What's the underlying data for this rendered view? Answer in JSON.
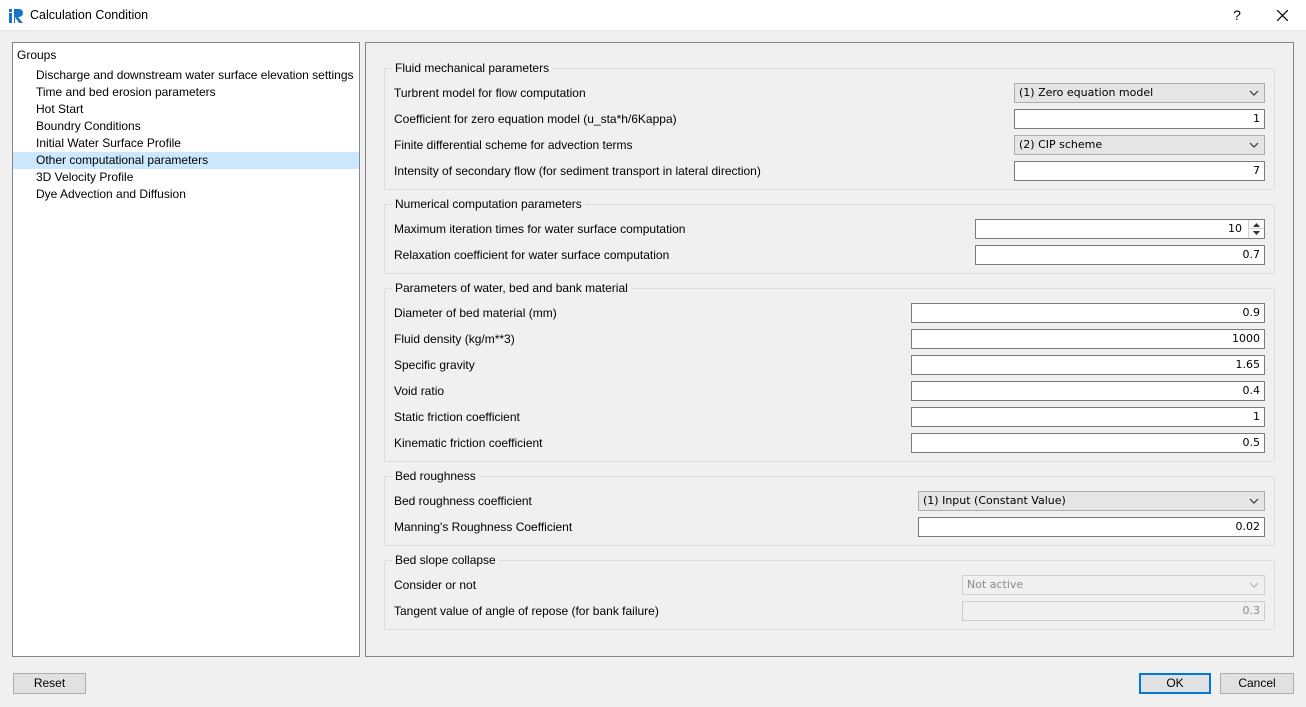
{
  "window": {
    "title": "Calculation Condition",
    "help": "?",
    "close": "✕"
  },
  "groups": {
    "header": "Groups",
    "items": [
      "Discharge and downstream water surface elevation settings",
      "Time and bed erosion parameters",
      "Hot Start",
      "Boundry Conditions",
      "Initial Water Surface Profile",
      "Other computational parameters",
      "3D Velocity Profile",
      "Dye Advection and Diffusion"
    ],
    "selected_index": 5
  },
  "fluid": {
    "title": "Fluid mechanical parameters",
    "turb_label": "Turbrent model for flow computation",
    "turb_value": "(1) Zero equation model",
    "coef_label": "Coefficient for zero equation model (u_sta*h/6Kappa)",
    "coef_value": "1",
    "scheme_label": "Finite differential scheme for advection terms",
    "scheme_value": "(2) CIP scheme",
    "secondary_label": "Intensity of secondary flow (for sediment transport in lateral direction)",
    "secondary_value": "7"
  },
  "numerical": {
    "title": "Numerical computation parameters",
    "iter_label": "Maximum iteration times for water surface computation",
    "iter_value": "10",
    "relax_label": "Relaxation coefficient for water surface computation",
    "relax_value": "0.7"
  },
  "material": {
    "title": "Parameters of water, bed and bank material",
    "diameter_label": "Diameter of bed material (mm)",
    "diameter_value": "0.9",
    "density_label": "Fluid density (kg/m**3)",
    "density_value": "1000",
    "gravity_label": "Specific gravity",
    "gravity_value": "1.65",
    "void_label": "Void ratio",
    "void_value": "0.4",
    "static_label": "Static friction coefficient",
    "static_value": "1",
    "kinematic_label": "Kinematic friction coefficient",
    "kinematic_value": "0.5"
  },
  "roughness": {
    "title": "Bed roughness",
    "coef_label": "Bed roughness coefficient",
    "coef_value": "(1) Input (Constant Value)",
    "manning_label": "Manning's Roughness Coefficient",
    "manning_value": "0.02"
  },
  "slope": {
    "title": "Bed slope collapse",
    "consider_label": "Consider or not",
    "consider_value": "Not active",
    "tangent_label": "Tangent value of angle of repose (for bank failure)",
    "tangent_value": "0.3"
  },
  "buttons": {
    "reset": "Reset",
    "ok": "OK",
    "cancel": "Cancel"
  },
  "colors": {
    "selection": "#cce8ff",
    "default_button": "#0078d7",
    "app_icon": "#1a73c8"
  }
}
